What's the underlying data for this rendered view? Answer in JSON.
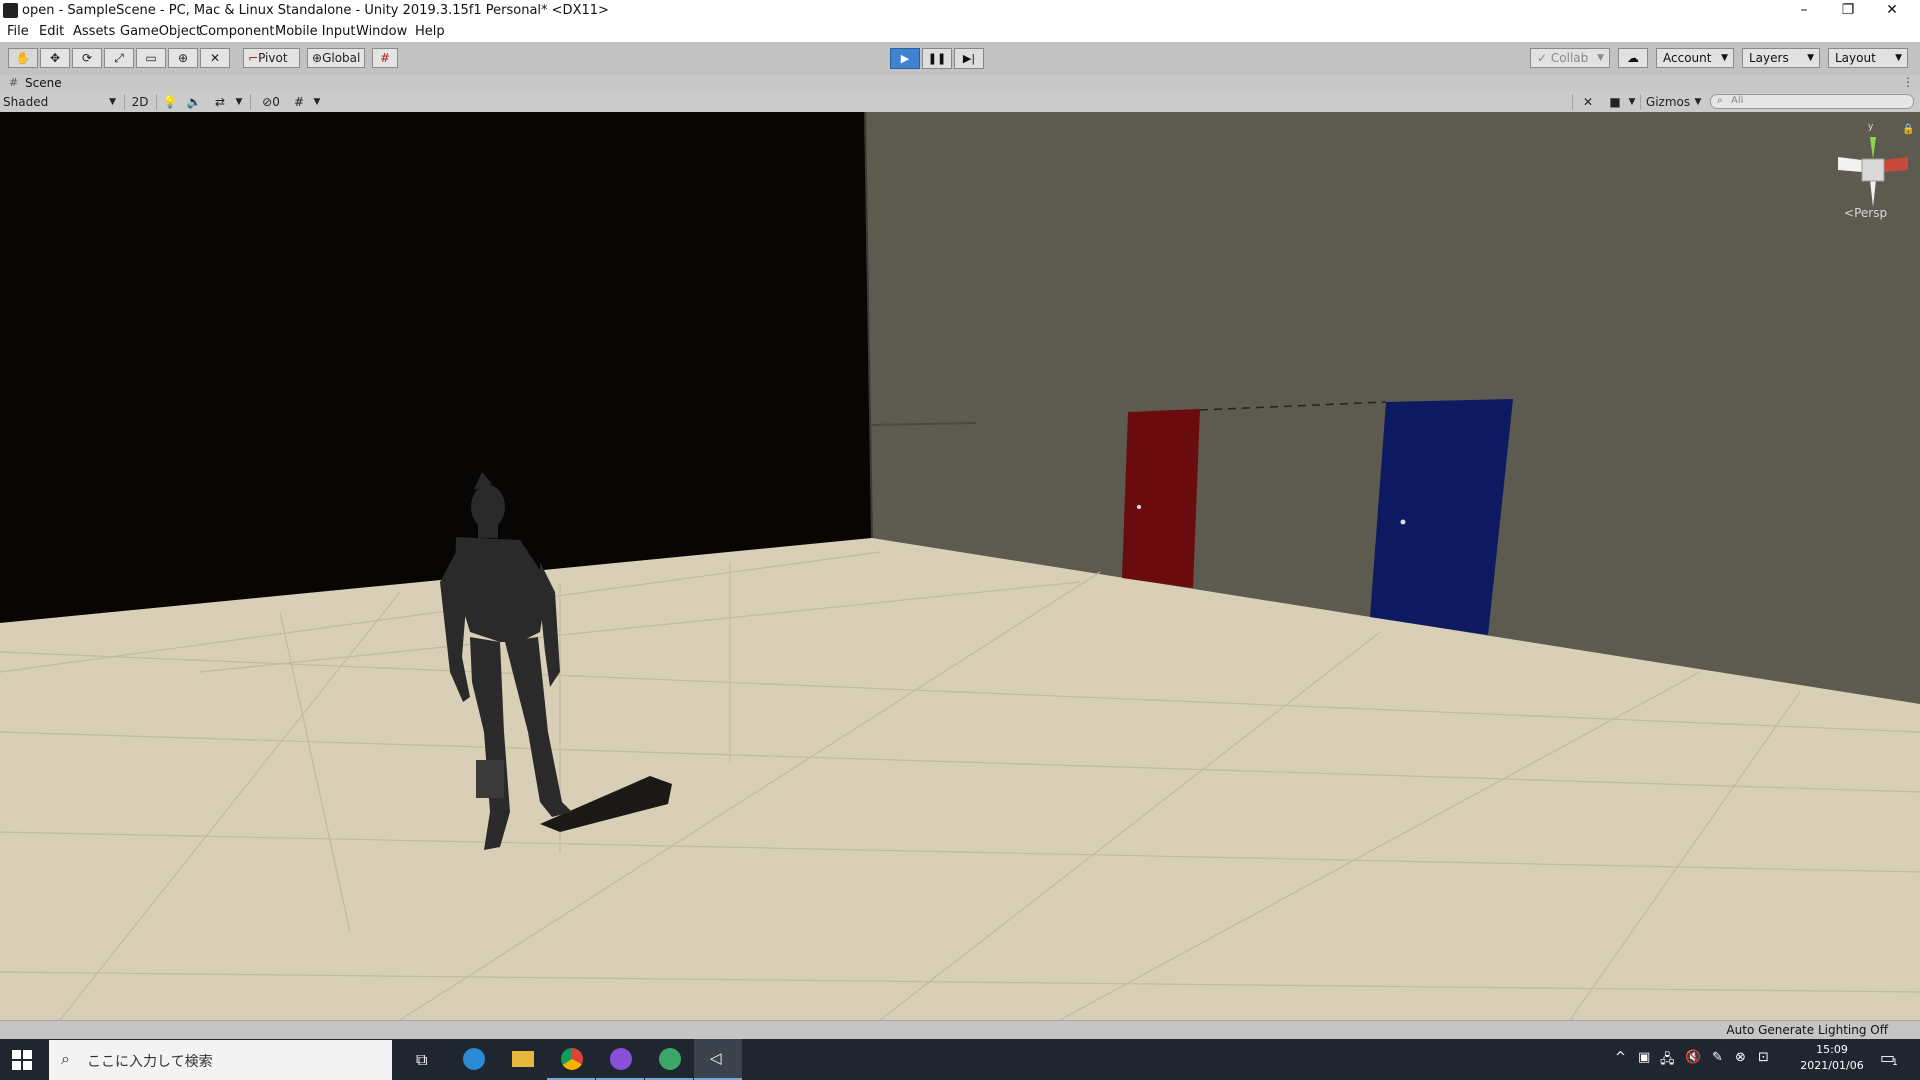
{
  "window": {
    "title": "open - SampleScene - PC, Mac & Linux Standalone - Unity 2019.3.15f1 Personal* <DX11>",
    "controls": [
      "–",
      "❐",
      "✕"
    ]
  },
  "menu": [
    "File",
    "Edit",
    "Assets",
    "GameObject",
    "Component",
    "Mobile Input",
    "Window",
    "Help"
  ],
  "toolbar": {
    "pivot_label": "Pivot",
    "global_label": "Global",
    "collab_label": "Collab",
    "account_label": "Account",
    "layers_label": "Layers",
    "layout_label": "Layout",
    "play_state": "playing"
  },
  "scene": {
    "tab_label": "Scene",
    "shading_mode": "Shaded",
    "mode_2d_label": "2D",
    "hidden_count": "0",
    "gizmos_label": "Gizmos",
    "search_placeholder": "All",
    "projection_label": "Persp",
    "axis_y_label": "y"
  },
  "status": {
    "lighting_text": "Auto Generate Lighting Off"
  },
  "taskbar": {
    "search_placeholder": "ここに入力して検索",
    "time": "15:09",
    "date": "2021/01/06",
    "notification_count": "1"
  },
  "colors": {
    "accent_play": "#3f82d0",
    "red_door": "#6a0b0d",
    "blue_door": "#0d1a62",
    "floor": "#d9cfb7",
    "wall": "#5d5a4f",
    "sky": "#070605"
  }
}
